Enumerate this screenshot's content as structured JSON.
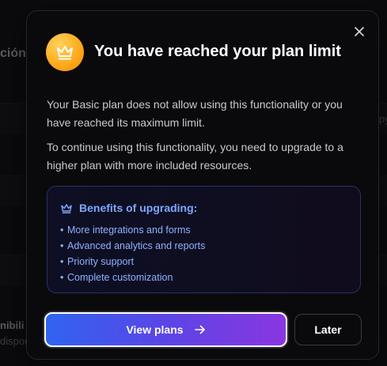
{
  "background": {
    "partial_heading": "ción",
    "partial_right": "py",
    "partial_bottom_1": "nibili",
    "partial_bottom_2": "dispon"
  },
  "modal": {
    "close_icon": "close-icon",
    "crown_icon": "crown-icon",
    "title": "You have reached your plan limit",
    "paragraph_1": "Your Basic plan does not allow using this functionality or you have reached its maximum limit.",
    "paragraph_2": "To continue using this functionality, you need to upgrade to a higher plan with more included resources.",
    "benefits": {
      "title": "Benefits of upgrading:",
      "items": [
        "More integrations and forms",
        "Advanced analytics and reports",
        "Priority support",
        "Complete customization"
      ]
    },
    "primary_button": "View plans",
    "secondary_button": "Later"
  },
  "colors": {
    "accent_start": "#3064f0",
    "accent_end": "#8a36e0",
    "benefit_text": "#8eb1ff",
    "crown_gold": "#ffab1f"
  }
}
